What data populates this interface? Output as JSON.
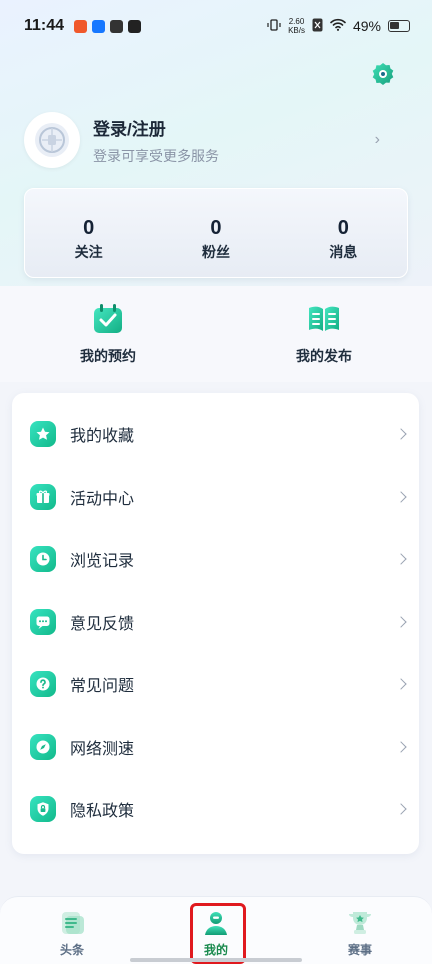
{
  "status_bar": {
    "time": "11:44",
    "net_speed_value": "2.60",
    "net_speed_unit": "KB/s",
    "battery": "49%"
  },
  "profile": {
    "title": "登录/注册",
    "subtitle": "登录可享受更多服务"
  },
  "stats": [
    {
      "value": "0",
      "label": "关注"
    },
    {
      "value": "0",
      "label": "粉丝"
    },
    {
      "value": "0",
      "label": "消息"
    }
  ],
  "quick_actions": [
    {
      "label": "我的预约",
      "icon": "calendar-check-icon"
    },
    {
      "label": "我的发布",
      "icon": "book-open-icon"
    }
  ],
  "menu": [
    {
      "label": "我的收藏",
      "icon": "star-icon"
    },
    {
      "label": "活动中心",
      "icon": "gift-icon"
    },
    {
      "label": "浏览记录",
      "icon": "clock-icon"
    },
    {
      "label": "意见反馈",
      "icon": "chat-bubble-icon"
    },
    {
      "label": "常见问题",
      "icon": "question-icon"
    },
    {
      "label": "网络测速",
      "icon": "compass-icon"
    },
    {
      "label": "隐私政策",
      "icon": "shield-lock-icon"
    }
  ],
  "tabbar": [
    {
      "label": "头条",
      "icon": "news-icon",
      "active": false
    },
    {
      "label": "我的",
      "icon": "user-icon",
      "active": true
    },
    {
      "label": "赛事",
      "icon": "trophy-icon",
      "active": false
    }
  ],
  "colors": {
    "accent": "#14b98a",
    "active_tab": "#1a8a4e",
    "highlight": "#e0191e"
  }
}
